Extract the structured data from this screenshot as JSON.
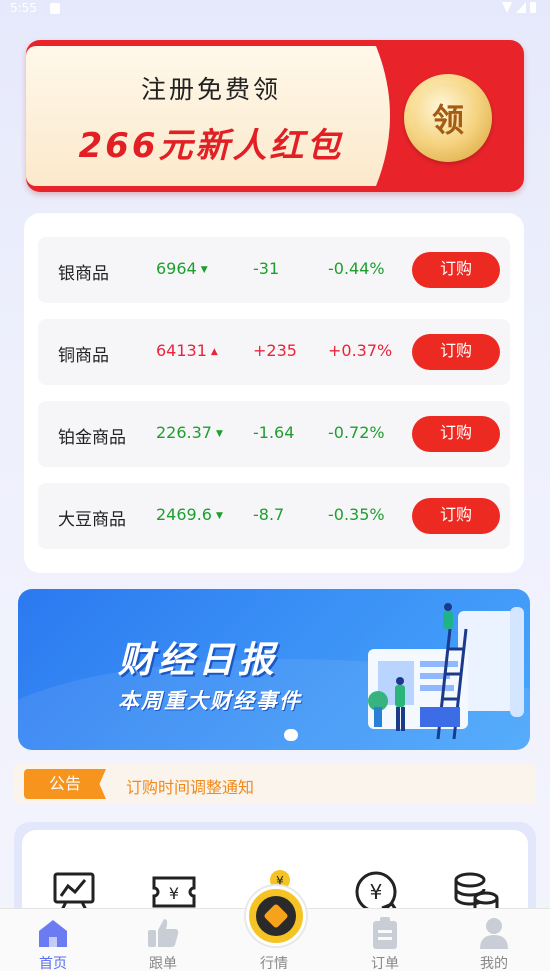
{
  "status_bar": {
    "time": "5:55"
  },
  "promo": {
    "line1": "注册免费领",
    "line2": "266元新人红包",
    "coin_label": "领"
  },
  "market": {
    "rows": [
      {
        "name": "银商品",
        "price": "6964",
        "direction": "down",
        "change": "-31",
        "percent": "-0.44%",
        "button": "订购"
      },
      {
        "name": "铜商品",
        "price": "64131",
        "direction": "up",
        "change": "+235",
        "percent": "+0.37%",
        "button": "订购"
      },
      {
        "name": "铂金商品",
        "price": "226.37",
        "direction": "down",
        "change": "-1.64",
        "percent": "-0.72%",
        "button": "订购"
      },
      {
        "name": "大豆商品",
        "price": "2469.6",
        "direction": "down",
        "change": "-8.7",
        "percent": "-0.35%",
        "button": "订购"
      }
    ],
    "colors": {
      "down": "#1e9e2f",
      "up": "#e8253b",
      "button": "#ec2a21"
    }
  },
  "report": {
    "title": "财经日报",
    "subtitle": "本周重大财经事件"
  },
  "notice": {
    "tag": "公告",
    "text": "订购时间调整通知"
  },
  "quick_menu": {
    "icons": [
      "chart-board-icon",
      "ticket-icon",
      "piggy-bank-icon",
      "yuan-exchange-icon",
      "coins-stack-icon"
    ]
  },
  "bottom_nav": {
    "items": [
      {
        "label": "首页",
        "icon": "home-icon",
        "active": true
      },
      {
        "label": "跟单",
        "icon": "thumbs-up-icon",
        "active": false
      },
      {
        "label": "行情",
        "icon": "coin-icon",
        "active": false
      },
      {
        "label": "订单",
        "icon": "clipboard-icon",
        "active": false
      },
      {
        "label": "我的",
        "icon": "user-icon",
        "active": false
      }
    ],
    "active_color": "#5a6ef0"
  }
}
